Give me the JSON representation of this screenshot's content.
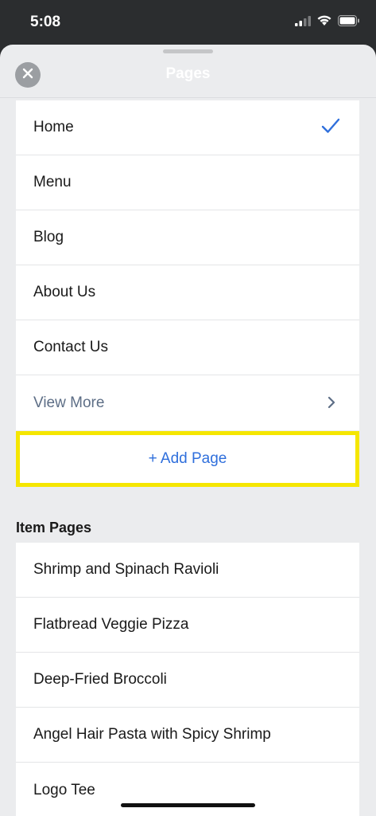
{
  "status": {
    "time": "5:08"
  },
  "header": {
    "title": "Pages"
  },
  "pages": [
    {
      "label": "Home",
      "selected": true
    },
    {
      "label": "Menu"
    },
    {
      "label": "Blog"
    },
    {
      "label": "About Us"
    },
    {
      "label": "Contact Us"
    }
  ],
  "view_more": {
    "label": "View More"
  },
  "add_page": {
    "label": "+ Add Page"
  },
  "item_pages": {
    "title": "Item Pages",
    "items": [
      "Shrimp and Spinach Ravioli",
      "Flatbread Veggie Pizza",
      "Deep-Fried Broccoli",
      "Angel Hair Pasta with Spicy Shrimp",
      "Logo Tee"
    ]
  },
  "colors": {
    "accent": "#2f6fdc",
    "highlight": "#f5e600",
    "background": "#ebecee"
  }
}
